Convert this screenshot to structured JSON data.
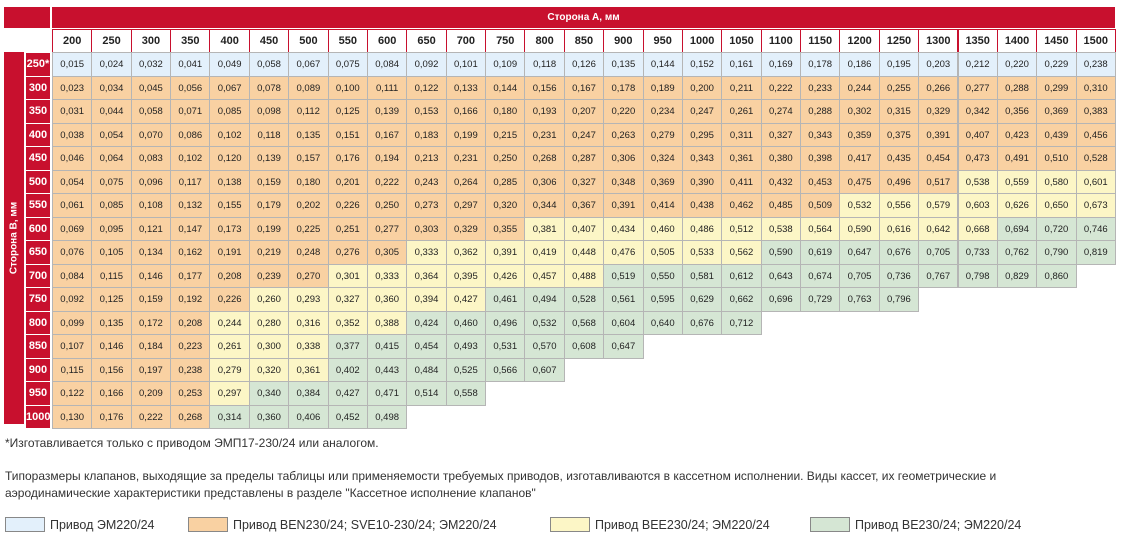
{
  "header_a": "Сторона А, мм",
  "header_b": "Сторона В, мм",
  "colors": {
    "c1": "#e3f0fb",
    "c2": "#f9d1a2",
    "c3": "#fcf6c6",
    "c4": "#d5e6d4",
    "accent": "#c8102e"
  },
  "columns": [
    "200",
    "250",
    "300",
    "350",
    "400",
    "450",
    "500",
    "550",
    "600",
    "650",
    "700",
    "750",
    "800",
    "850",
    "900",
    "950",
    "1000",
    "1050",
    "1100",
    "1150",
    "1200",
    "1250",
    "1300",
    "1350",
    "1400",
    "1450",
    "1500"
  ],
  "rows": [
    {
      "label": "250*",
      "values": [
        "0,015",
        "0,024",
        "0,032",
        "0,041",
        "0,049",
        "0,058",
        "0,067",
        "0,075",
        "0,084",
        "0,092",
        "0,101",
        "0,109",
        "0,118",
        "0,126",
        "0,135",
        "0,144",
        "0,152",
        "0,161",
        "0,169",
        "0,178",
        "0,186",
        "0,195",
        "0,203",
        "0,212",
        "0,220",
        "0,229",
        "0,238"
      ],
      "colors": "111111111111111111111111111"
    },
    {
      "label": "300",
      "values": [
        "0,023",
        "0,034",
        "0,045",
        "0,056",
        "0,067",
        "0,078",
        "0,089",
        "0,100",
        "0,111",
        "0,122",
        "0,133",
        "0,144",
        "0,156",
        "0,167",
        "0,178",
        "0,189",
        "0,200",
        "0,211",
        "0,222",
        "0,233",
        "0,244",
        "0,255",
        "0,266",
        "0,277",
        "0,288",
        "0,299",
        "0,310"
      ],
      "colors": "222222222222222222222222222"
    },
    {
      "label": "350",
      "values": [
        "0,031",
        "0,044",
        "0,058",
        "0,071",
        "0,085",
        "0,098",
        "0,112",
        "0,125",
        "0,139",
        "0,153",
        "0,166",
        "0,180",
        "0,193",
        "0,207",
        "0,220",
        "0,234",
        "0,247",
        "0,261",
        "0,274",
        "0,288",
        "0,302",
        "0,315",
        "0,329",
        "0,342",
        "0,356",
        "0,369",
        "0,383"
      ],
      "colors": "222222222222222222222222222"
    },
    {
      "label": "400",
      "values": [
        "0,038",
        "0,054",
        "0,070",
        "0,086",
        "0,102",
        "0,118",
        "0,135",
        "0,151",
        "0,167",
        "0,183",
        "0,199",
        "0,215",
        "0,231",
        "0,247",
        "0,263",
        "0,279",
        "0,295",
        "0,311",
        "0,327",
        "0,343",
        "0,359",
        "0,375",
        "0,391",
        "0,407",
        "0,423",
        "0,439",
        "0,456"
      ],
      "colors": "222222222222222222222222222"
    },
    {
      "label": "450",
      "values": [
        "0,046",
        "0,064",
        "0,083",
        "0,102",
        "0,120",
        "0,139",
        "0,157",
        "0,176",
        "0,194",
        "0,213",
        "0,231",
        "0,250",
        "0,268",
        "0,287",
        "0,306",
        "0,324",
        "0,343",
        "0,361",
        "0,380",
        "0,398",
        "0,417",
        "0,435",
        "0,454",
        "0,473",
        "0,491",
        "0,510",
        "0,528"
      ],
      "colors": "222222222222222222222222222"
    },
    {
      "label": "500",
      "values": [
        "0,054",
        "0,075",
        "0,096",
        "0,117",
        "0,138",
        "0,159",
        "0,180",
        "0,201",
        "0,222",
        "0,243",
        "0,264",
        "0,285",
        "0,306",
        "0,327",
        "0,348",
        "0,369",
        "0,390",
        "0,411",
        "0,432",
        "0,453",
        "0,475",
        "0,496",
        "0,517",
        "0,538",
        "0,559",
        "0,580",
        "0,601"
      ],
      "colors": "222222222222222222222223333"
    },
    {
      "label": "550",
      "values": [
        "0,061",
        "0,085",
        "0,108",
        "0,132",
        "0,155",
        "0,179",
        "0,202",
        "0,226",
        "0,250",
        "0,273",
        "0,297",
        "0,320",
        "0,344",
        "0,367",
        "0,391",
        "0,414",
        "0,438",
        "0,462",
        "0,485",
        "0,509",
        "0,532",
        "0,556",
        "0,579",
        "0,603",
        "0,626",
        "0,650",
        "0,673"
      ],
      "colors": "222222222222222222223333333"
    },
    {
      "label": "600",
      "values": [
        "0,069",
        "0,095",
        "0,121",
        "0,147",
        "0,173",
        "0,199",
        "0,225",
        "0,251",
        "0,277",
        "0,303",
        "0,329",
        "0,355",
        "0,381",
        "0,407",
        "0,434",
        "0,460",
        "0,486",
        "0,512",
        "0,538",
        "0,564",
        "0,590",
        "0,616",
        "0,642",
        "0,668",
        "0,694",
        "0,720",
        "0,746"
      ],
      "colors": "222222222222333333333333444"
    },
    {
      "label": "650",
      "values": [
        "0,076",
        "0,105",
        "0,134",
        "0,162",
        "0,191",
        "0,219",
        "0,248",
        "0,276",
        "0,305",
        "0,333",
        "0,362",
        "0,391",
        "0,419",
        "0,448",
        "0,476",
        "0,505",
        "0,533",
        "0,562",
        "0,590",
        "0,619",
        "0,647",
        "0,676",
        "0,705",
        "0,733",
        "0,762",
        "0,790",
        "0,819"
      ],
      "colors": "222222222333333333444444444"
    },
    {
      "label": "700",
      "values": [
        "0,084",
        "0,115",
        "0,146",
        "0,177",
        "0,208",
        "0,239",
        "0,270",
        "0,301",
        "0,333",
        "0,364",
        "0,395",
        "0,426",
        "0,457",
        "0,488",
        "0,519",
        "0,550",
        "0,581",
        "0,612",
        "0,643",
        "0,674",
        "0,705",
        "0,736",
        "0,767",
        "0,798",
        "0,829",
        "0,860"
      ],
      "colors": "22222223333333444444444444"
    },
    {
      "label": "750",
      "values": [
        "0,092",
        "0,125",
        "0,159",
        "0,192",
        "0,226",
        "0,260",
        "0,293",
        "0,327",
        "0,360",
        "0,394",
        "0,427",
        "0,461",
        "0,494",
        "0,528",
        "0,561",
        "0,595",
        "0,629",
        "0,662",
        "0,696",
        "0,729",
        "0,763",
        "0,796"
      ],
      "colors": "2222233333344444444444"
    },
    {
      "label": "800",
      "values": [
        "0,099",
        "0,135",
        "0,172",
        "0,208",
        "0,244",
        "0,280",
        "0,316",
        "0,352",
        "0,388",
        "0,424",
        "0,460",
        "0,496",
        "0,532",
        "0,568",
        "0,604",
        "0,640",
        "0,676",
        "0,712"
      ],
      "colors": "222233333444444444"
    },
    {
      "label": "850",
      "values": [
        "0,107",
        "0,146",
        "0,184",
        "0,223",
        "0,261",
        "0,300",
        "0,338",
        "0,377",
        "0,415",
        "0,454",
        "0,493",
        "0,531",
        "0,570",
        "0,608",
        "0,647"
      ],
      "colors": "222233344444444"
    },
    {
      "label": "900",
      "values": [
        "0,115",
        "0,156",
        "0,197",
        "0,238",
        "0,279",
        "0,320",
        "0,361",
        "0,402",
        "0,443",
        "0,484",
        "0,525",
        "0,566",
        "0,607"
      ],
      "colors": "2222333444444"
    },
    {
      "label": "950",
      "values": [
        "0,122",
        "0,166",
        "0,209",
        "0,253",
        "0,297",
        "0,340",
        "0,384",
        "0,427",
        "0,471",
        "0,514",
        "0,558"
      ],
      "colors": "22223444444"
    },
    {
      "label": "1000",
      "values": [
        "0,130",
        "0,176",
        "0,222",
        "0,268",
        "0,314",
        "0,360",
        "0,406",
        "0,452",
        "0,498"
      ],
      "colors": "222244444"
    }
  ],
  "footnote": "*Изготавливается только с приводом ЭМП17-230/24 или аналогом.",
  "description": "Типоразмеры клапанов, выходящие за пределы таблицы или применяемости требуемых приводов, изготавливаются в кассетном исполнении. Виды кассет, их геометрические и аэродинамические характеристики представлены в разделе \"Кассетное исполнение клапанов\"",
  "legend": [
    {
      "label": "Привод ЭМ220/24",
      "color": "c1"
    },
    {
      "label": "Привод BEN230/24; SVE10-230/24; ЭМ220/24",
      "color": "c2"
    },
    {
      "label": "Привод BEE230/24; ЭМ220/24",
      "color": "c3"
    },
    {
      "label": "Привод BE230/24; ЭМ220/24",
      "color": "c4"
    }
  ]
}
